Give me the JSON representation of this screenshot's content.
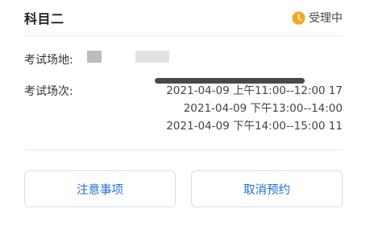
{
  "header": {
    "title": "科目二",
    "status_label": "受理中",
    "status_icon": "clock-icon",
    "status_color": "#f5a623"
  },
  "venue": {
    "label": "考试场地:"
  },
  "sessions": {
    "label": "考试场次:",
    "items": [
      "2021-04-09 上午11:00--12:00 17",
      "2021-04-09 下午13:00--14:00",
      "2021-04-09 下午14:00--15:00 11"
    ]
  },
  "actions": {
    "notice_label": "注意事项",
    "cancel_label": "取消预约",
    "accent_color": "#1f6fd6"
  }
}
